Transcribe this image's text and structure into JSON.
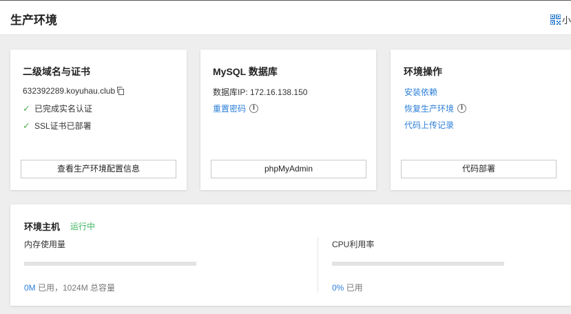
{
  "header": {
    "title": "生产环境",
    "qr_label": "小"
  },
  "domain_card": {
    "title": "二级域名与证书",
    "domain": "632392289.koyuhau.club",
    "items": [
      "已完成实名认证",
      "SSL证书已部署"
    ],
    "button": "查看生产环境配置信息"
  },
  "mysql_card": {
    "title": "MySQL 数据库",
    "ip_text": "数据库IP: 172.16.138.150",
    "reset_link": "重置密码",
    "button": "phpMyAdmin"
  },
  "ops_card": {
    "title": "环境操作",
    "links": [
      "安装依赖",
      "恢复生产环境",
      "代码上传记录"
    ],
    "button": "代码部署"
  },
  "host": {
    "title": "环境主机",
    "status": "运行中",
    "status_color": "#3bb55e",
    "memory": {
      "label": "内存使用量",
      "used": "0M",
      "used_suffix": " 已用，1024M 总容量",
      "fraction": 0
    },
    "cpu": {
      "label": "CPU利用率",
      "used": "0%",
      "used_suffix": " 已用",
      "fraction": 0
    }
  },
  "colors": {
    "link": "#2d7fd8",
    "check": "#4caf50"
  },
  "icons": [
    "qr-code-icon",
    "copy-icon",
    "check-icon",
    "info-icon"
  ]
}
